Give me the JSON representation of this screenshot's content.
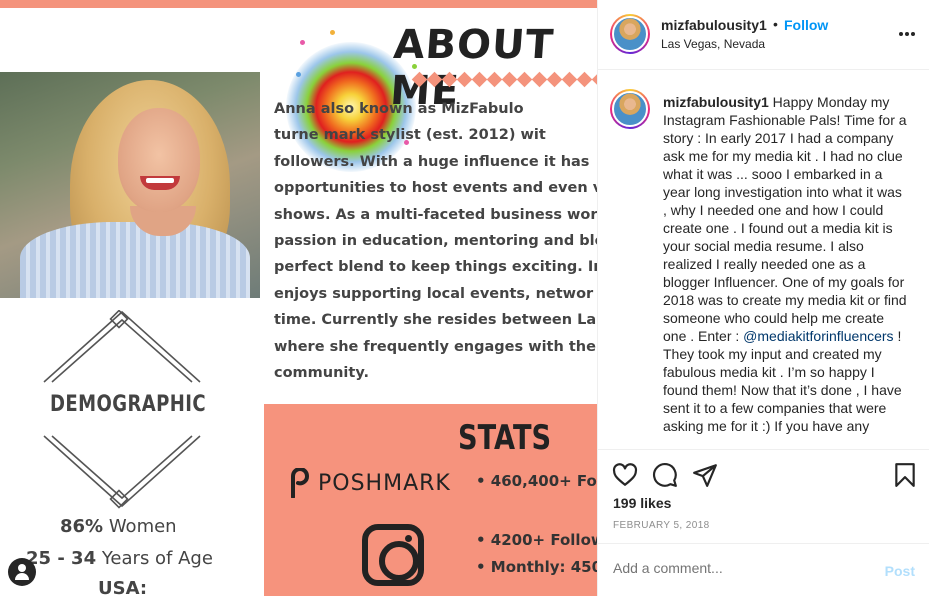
{
  "image": {
    "about_title": "ABOUT ME",
    "bio_lines": [
      "Anna             also known as MizFabulo",
      "turne      mark stylist (est. 2012) wit",
      "followers.  With a huge influence it has",
      "opportunities to host events and even v",
      "shows.  As a multi-faceted business wor",
      "passion in education, mentoring and blo",
      "perfect blend to keep things exciting. In",
      " enjoys supporting local events, networ",
      "time.   Currently she resides between La",
      "where she frequently engages with the",
      "community."
    ],
    "demographic_title": "DEMOGRAPHIC",
    "demographic_women_pct": "86%",
    "demographic_women_label": " Women",
    "demographic_age_range": "25 - 34",
    "demographic_age_label": " Years of Age",
    "demographic_country": "USA:",
    "stats_title": "STATS",
    "poshmark_label": "POSHMARK",
    "stat_poshmark": "•  460,400+ Fol",
    "stat_insta_followers": "•  4200+ Follow",
    "stat_insta_monthly": "•  Monthly: 450",
    "accent_color": "#f6937d"
  },
  "header": {
    "username": "mizfabulousity1",
    "separator": "•",
    "follow_label": "Follow",
    "location": "Las Vegas, Nevada",
    "more_icon": "more-horizontal-icon"
  },
  "caption": {
    "username": "mizfabulousity1",
    "text_before_mention": " Happy Monday my Instagram Fashionable Pals! Time for a story : In early 2017 I had a company ask me for my media kit . I had no clue what it was ... sooo I embarked in a year long investigation into what it was , why I needed one and how I could create one . I found out a media kit is your social media resume. I also realized I really needed one as a blogger Influencer. One of my goals for 2018 was to create my media kit or find someone who could help me create one . Enter : ",
    "mention": "@mediakitforinfluencers",
    "text_after_mention": " ! They took my input and created my fabulous media kit . I’m so happy I found them! Now that it’s done , I have sent it to a few companies that were asking me for it :) If you have any"
  },
  "actions": {
    "icons": [
      "heart-icon",
      "comment-icon",
      "share-icon",
      "bookmark-icon"
    ],
    "likes": "199 likes",
    "date": "FEBRUARY 5, 2018",
    "comment_placeholder": "Add a comment...",
    "post_label": "Post",
    "follow_color": "#0095f6"
  }
}
